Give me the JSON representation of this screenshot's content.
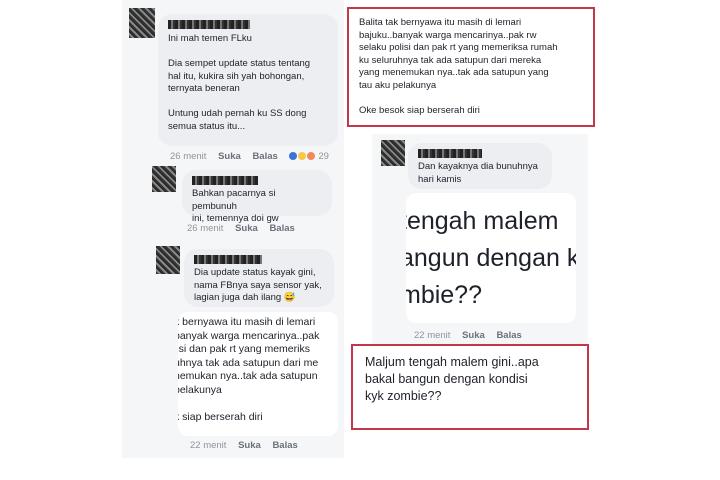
{
  "left_thread": {
    "c1": {
      "lines": "Ini mah temen FLku\n\nDia sempet update status tentang\nhal itu, kukira sih yah bohongan,\nternyata beneran\n\nUntung udah pernah ku SS dong\nsemua status itu...",
      "time": "26 menit",
      "like": "Suka",
      "reply": "Balas",
      "reaction_count": "29",
      "reactions": [
        "#3b73d6",
        "#f7c843",
        "#f08a5d"
      ]
    },
    "c2": {
      "lines": "Bahkan pacarnya si pembunuh\nini, temennya doi gw",
      "time": "26 menit",
      "like": "Suka",
      "reply": "Balas"
    },
    "c3": {
      "lines": "Dia update status kayak gini,\nnama FBnya saya sensor yak,\nlagian juga dah ilang 😅",
      "quote": "k bernyawa itu masih di lemari\nbanyak warga mencarinya..pak\nlisi dan pak rt yang memeriks\nuhnya tak ada satupun dari me\nnemukan nya..tak ada satupun\npelakunya\n\nk siap berserah diri",
      "time": "22 menit",
      "like": "Suka",
      "reply": "Balas"
    }
  },
  "right_thread": {
    "status_box": "Balita tak bernyawa itu masih di lemari\nbajuku..banyak warga mencarinya..pak rw\nselaku polisi dan pak rt yang memeriksa rumah\nku seluruhnya tak ada satupun dari mereka\nyang menemukan nya..tak ada satupun yang\ntau aku pelakunya\n\nOke besok siap berserah diri",
    "c1": {
      "lines": "Dan kayaknya dia bunuhnya\nhari kamis",
      "big": "tengah malem\nangun dengan k\nmbie??",
      "time": "22 menit",
      "like": "Suka",
      "reply": "Balas"
    },
    "status_box2": "Maljum tengah malem gini..apa\nbakal bangun dengan kondisi\nkyk zombie??"
  }
}
